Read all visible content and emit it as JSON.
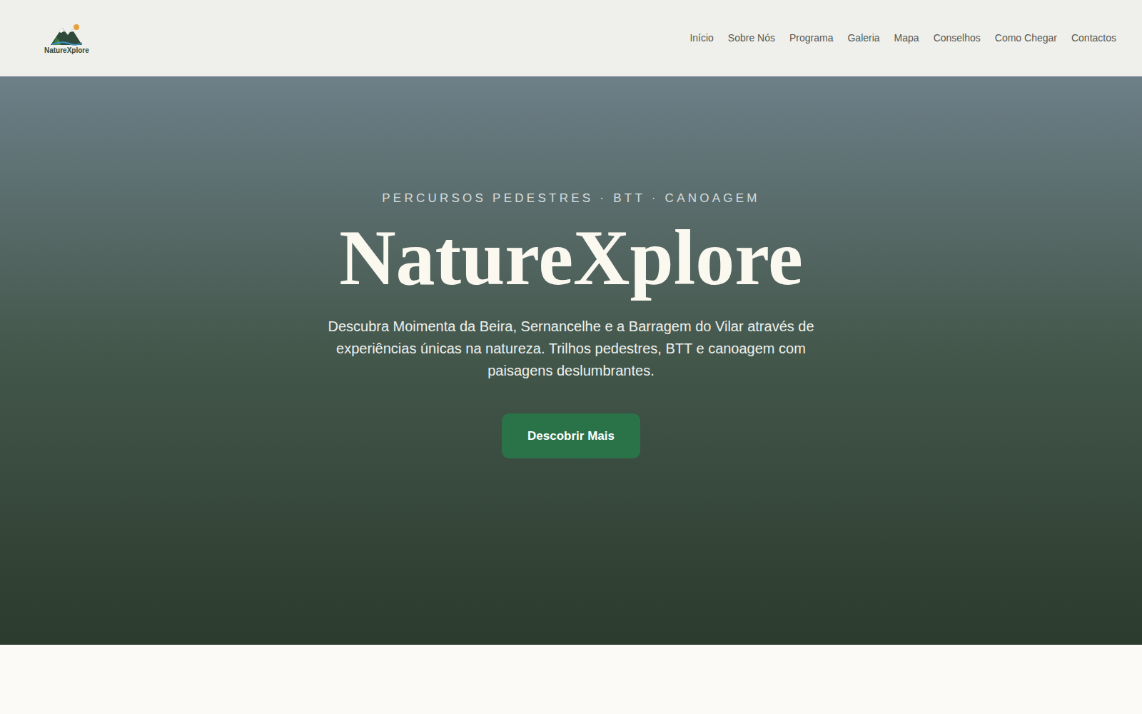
{
  "header": {
    "logo": {
      "text": "NatureXplore"
    },
    "nav": [
      {
        "label": "Início"
      },
      {
        "label": "Sobre Nós"
      },
      {
        "label": "Programa"
      },
      {
        "label": "Galeria"
      },
      {
        "label": "Mapa"
      },
      {
        "label": "Conselhos"
      },
      {
        "label": "Como Chegar"
      },
      {
        "label": "Contactos"
      }
    ]
  },
  "hero": {
    "eyebrow": "PERCURSOS PEDESTRES · BTT · CANOAGEM",
    "title": "NatureXplore",
    "description": "Descubra Moimenta da Beira, Sernancelhe e a Barragem do Vilar através de experiências únicas na natureza. Trilhos pedestres, BTT e canoagem com paisagens deslumbrantes.",
    "button": "Descobrir Mais"
  }
}
